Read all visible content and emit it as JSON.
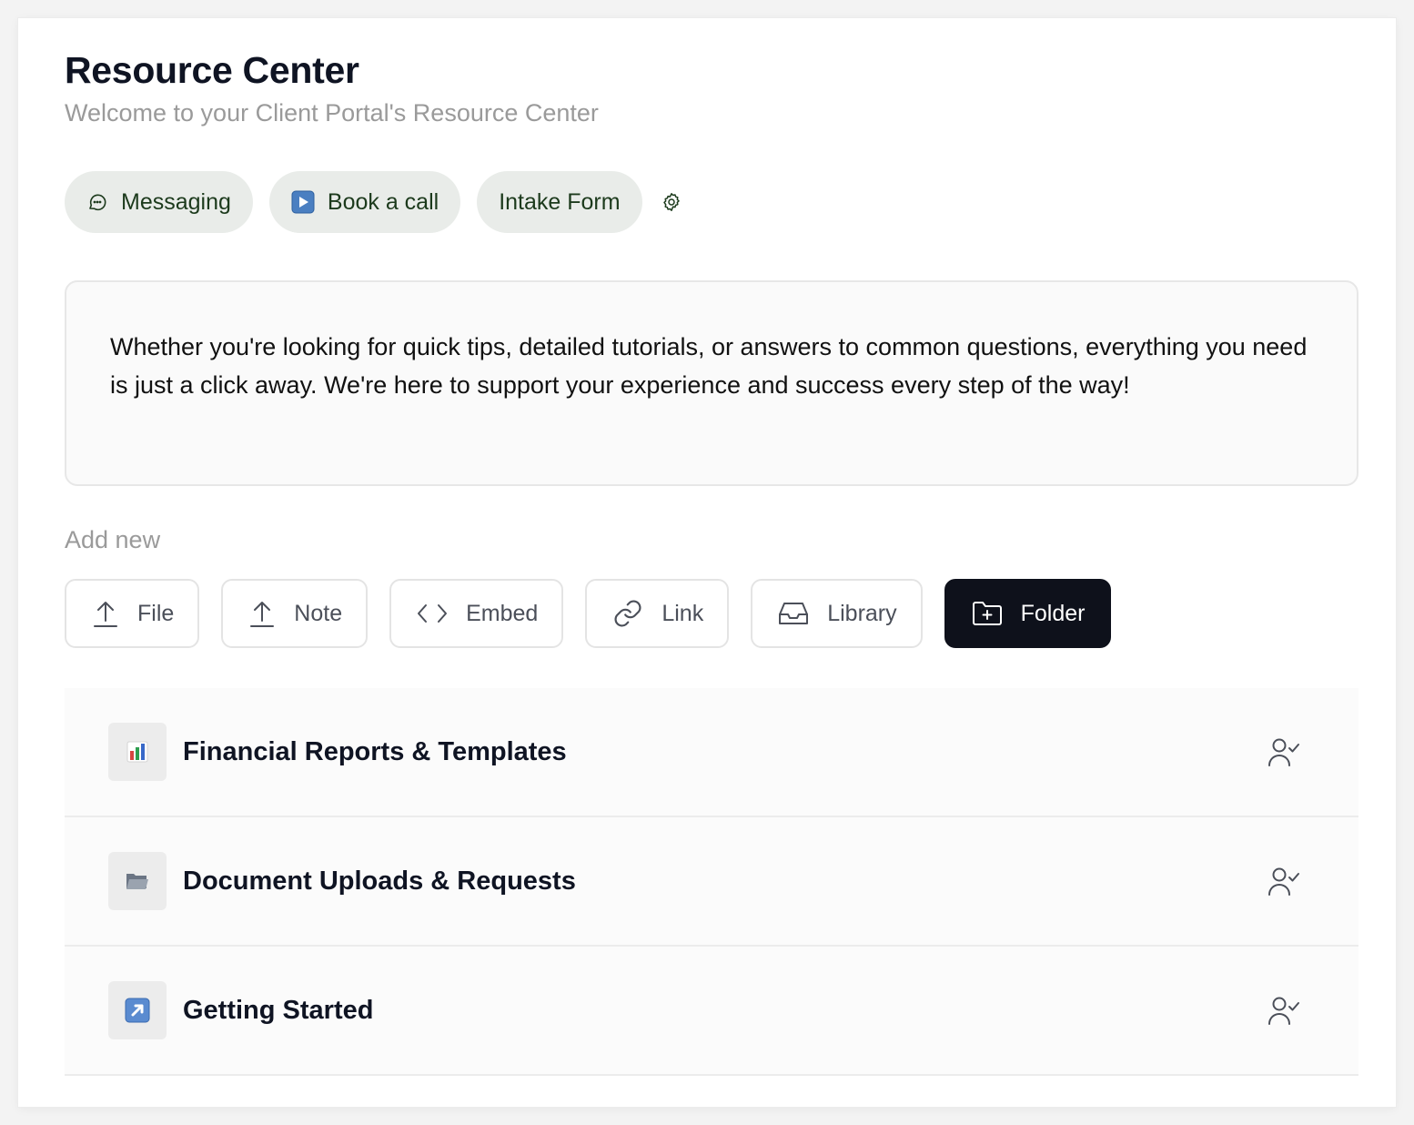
{
  "header": {
    "title": "Resource Center",
    "subtitle": "Welcome to your Client Portal's Resource Center"
  },
  "quick_actions": [
    {
      "label": "Messaging",
      "icon": "chat-bubble-icon"
    },
    {
      "label": "Book a call",
      "icon": "play-button-icon"
    },
    {
      "label": "Intake Form",
      "icon": ""
    }
  ],
  "settings_icon": "gear-icon",
  "intro_text": "Whether you're looking for quick tips, detailed tutorials, or answers to common questions, everything you need is just a click away. We're here to support your experience and success every step of the way!",
  "add_new": {
    "label": "Add new",
    "buttons": [
      {
        "label": "File",
        "icon": "upload-icon"
      },
      {
        "label": "Note",
        "icon": "upload-icon"
      },
      {
        "label": "Embed",
        "icon": "code-icon"
      },
      {
        "label": "Link",
        "icon": "link-icon"
      },
      {
        "label": "Library",
        "icon": "inbox-icon"
      },
      {
        "label": "Folder",
        "icon": "folder-plus-icon",
        "primary": true
      }
    ]
  },
  "folders": [
    {
      "name": "Financial Reports & Templates",
      "icon": "bar-chart-icon"
    },
    {
      "name": "Document Uploads & Requests",
      "icon": "open-folder-icon"
    },
    {
      "name": "Getting Started",
      "icon": "arrow-up-right-icon"
    }
  ],
  "colors": {
    "pill_bg": "#e9ece9",
    "pill_text": "#1c3a1c",
    "primary_button": "#0e111b",
    "subtitle": "#9a9a9a"
  }
}
